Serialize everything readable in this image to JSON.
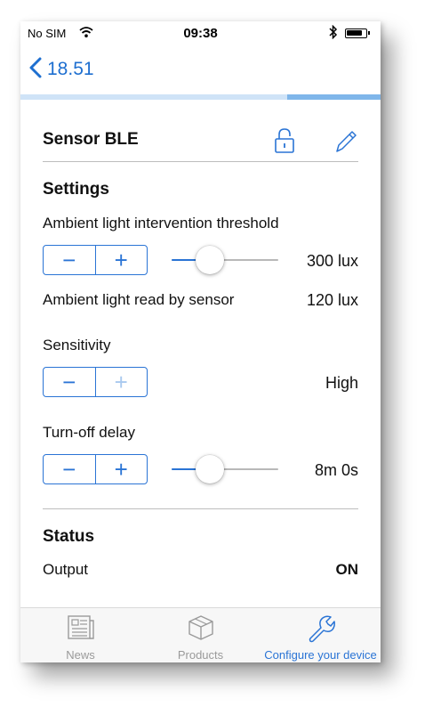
{
  "statusbar": {
    "carrier": "No SIM",
    "time": "09:38"
  },
  "nav": {
    "back_label": "18.51"
  },
  "progress": {
    "segments": 4,
    "active_segment": 4
  },
  "header": {
    "title": "Sensor BLE"
  },
  "settings": {
    "heading": "Settings",
    "ambient_threshold": {
      "label": "Ambient light intervention threshold",
      "value": "300 lux",
      "slider_fraction": 0.36
    },
    "ambient_read": {
      "label": "Ambient light read by sensor",
      "value": "120 lux"
    },
    "sensitivity": {
      "label": "Sensitivity",
      "value": "High",
      "plus_disabled": true
    },
    "turnoff_delay": {
      "label": "Turn-off delay",
      "value": "8m 0s",
      "slider_fraction": 0.36
    }
  },
  "status": {
    "heading": "Status",
    "output_label": "Output",
    "output_value": "ON"
  },
  "tabs": [
    {
      "label": "News",
      "icon": "newspaper-icon",
      "active": false
    },
    {
      "label": "Products",
      "icon": "box-icon",
      "active": false
    },
    {
      "label": "Configure your device",
      "icon": "wrench-icon",
      "active": true
    }
  ],
  "colors": {
    "accent": "#2a74d5",
    "progress_light": "#cfe3f7",
    "progress_active": "#7fb6ea",
    "tab_inactive": "#9a9a9a"
  }
}
